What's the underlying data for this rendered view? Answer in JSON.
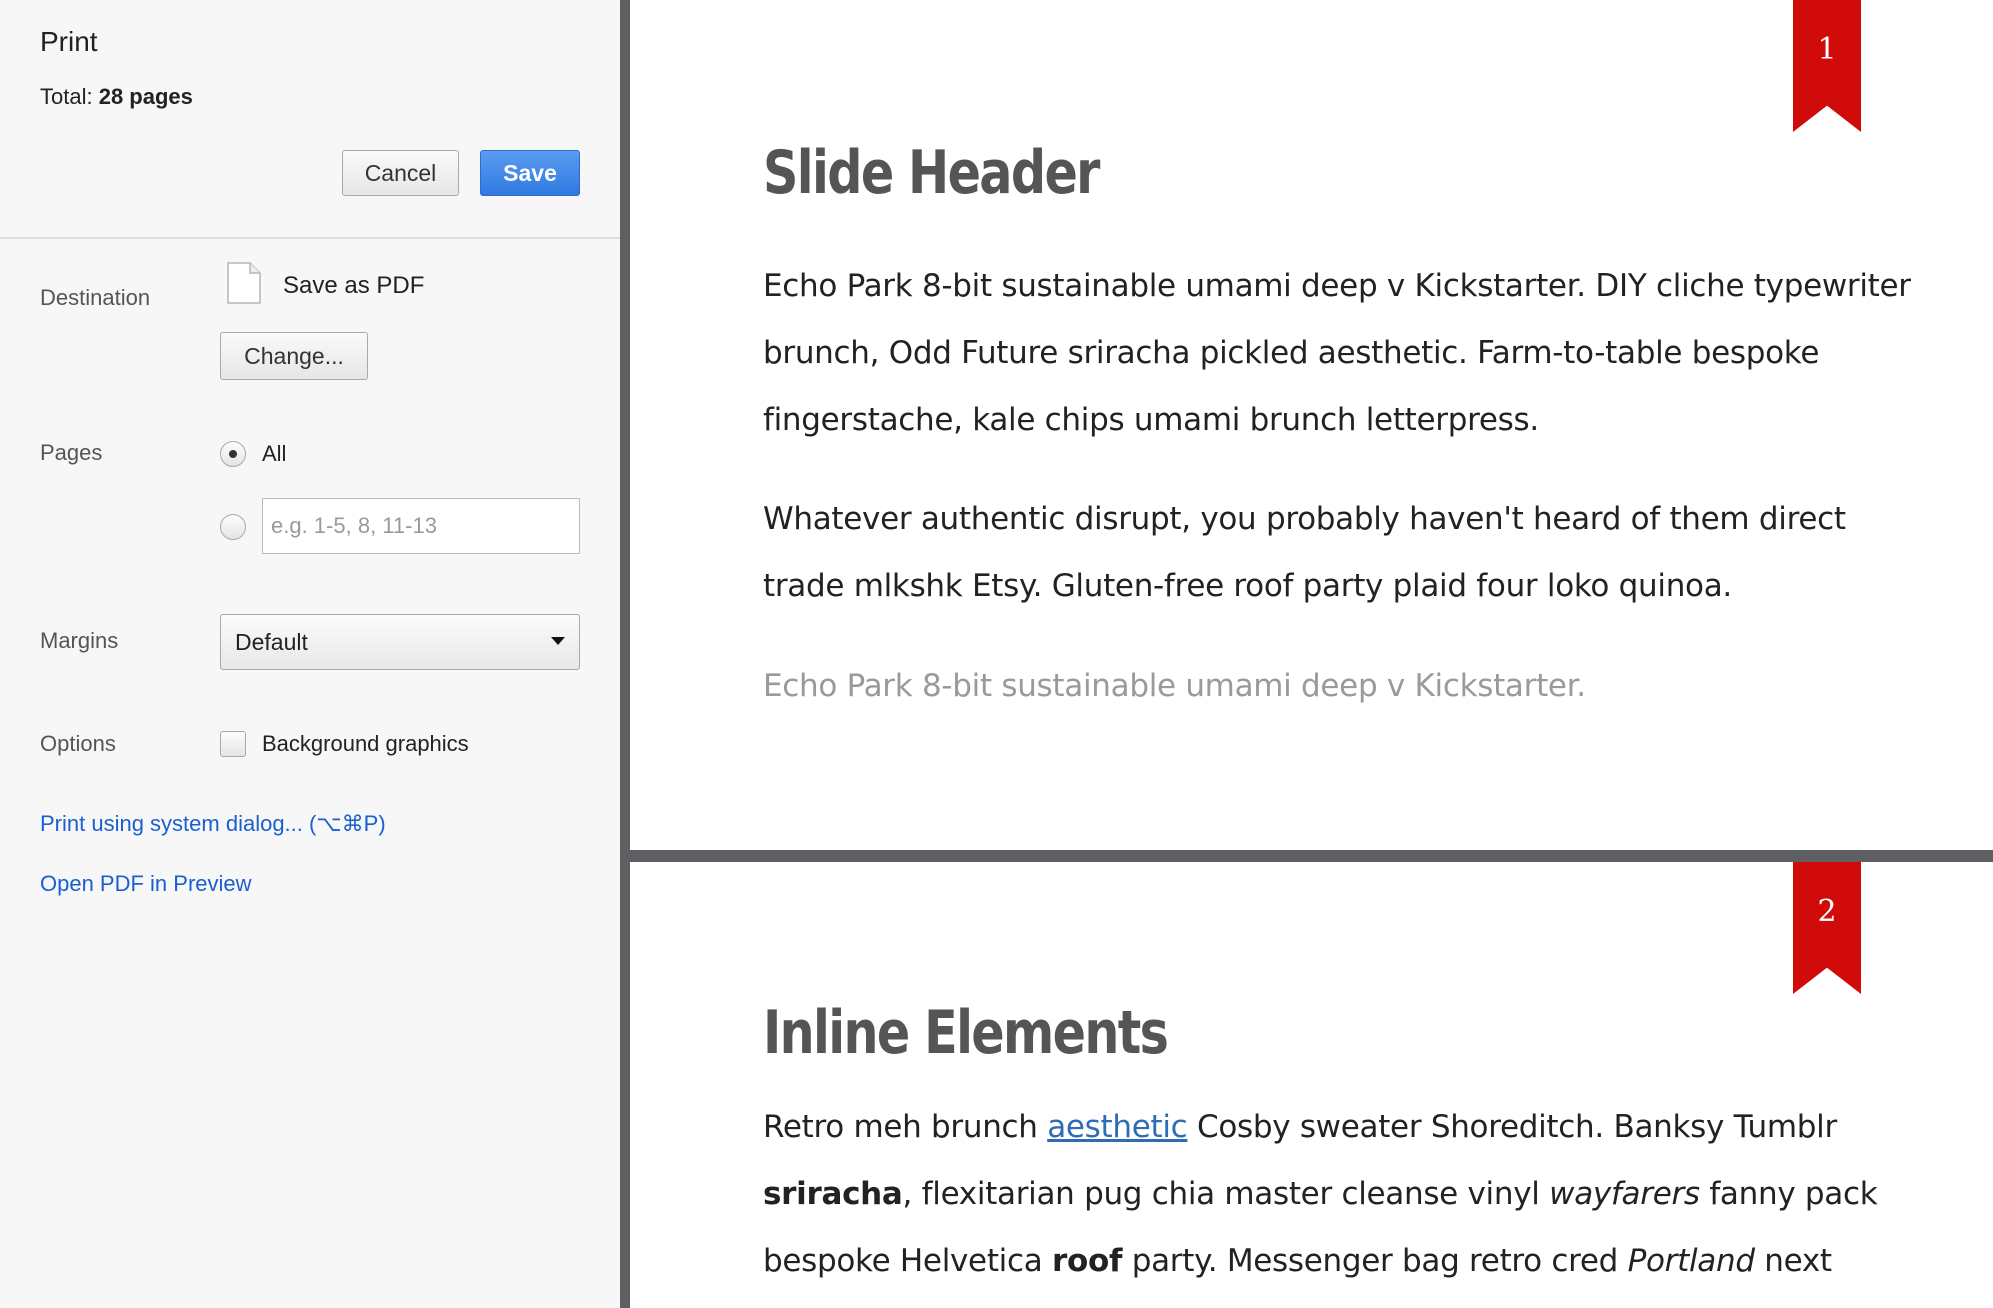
{
  "panel": {
    "title": "Print",
    "total_label": "Total:",
    "total_value": "28 pages",
    "cancel_label": "Cancel",
    "save_label": "Save",
    "destination": {
      "label": "Destination",
      "name": "Save as PDF",
      "change_label": "Change..."
    },
    "pages": {
      "label": "Pages",
      "all_label": "All",
      "all_selected": true,
      "range_placeholder": "e.g. 1-5, 8, 11-13",
      "range_value": ""
    },
    "margins": {
      "label": "Margins",
      "selected": "Default"
    },
    "options": {
      "label": "Options",
      "background_graphics_label": "Background graphics",
      "background_graphics_checked": false
    },
    "links": {
      "system_dialog": "Print using system dialog... (⌥⌘P)",
      "open_preview": "Open PDF in Preview"
    },
    "colors": {
      "save_button": "#3b84e8",
      "link": "#1a5fd0"
    }
  },
  "preview": {
    "ribbon_color": "#d10a0a",
    "page1": {
      "number": "1",
      "title": "Slide Header",
      "para1": "Echo Park 8-bit sustainable umami deep v Kickstarter. DIY cliche typewriter brunch, Odd Future sriracha pickled aesthetic. Farm-to-table bespoke fingerstache, kale chips umami brunch letterpress.",
      "para2": "Whatever authentic disrupt, you probably haven't heard of them direct trade mlkshk Etsy. Gluten-free roof party plaid four loko quinoa.",
      "para3": "Echo Park 8-bit sustainable umami deep v Kickstarter."
    },
    "page2": {
      "number": "2",
      "title": "Inline Elements",
      "para": {
        "t1": "Retro meh brunch ",
        "link": "aesthetic",
        "t2": " Cosby sweater Shoreditch. Banksy Tumblr ",
        "bold1": "sriracha",
        "t3": ", flexitarian pug chia master cleanse vinyl ",
        "italic1": "wayfarers",
        "t4": " fanny pack bespoke Helvetica ",
        "bold2": "roof",
        "t5": " party. Messenger bag retro cred ",
        "italic2": "Portland",
        "t6": " next level. Yr"
      }
    }
  }
}
